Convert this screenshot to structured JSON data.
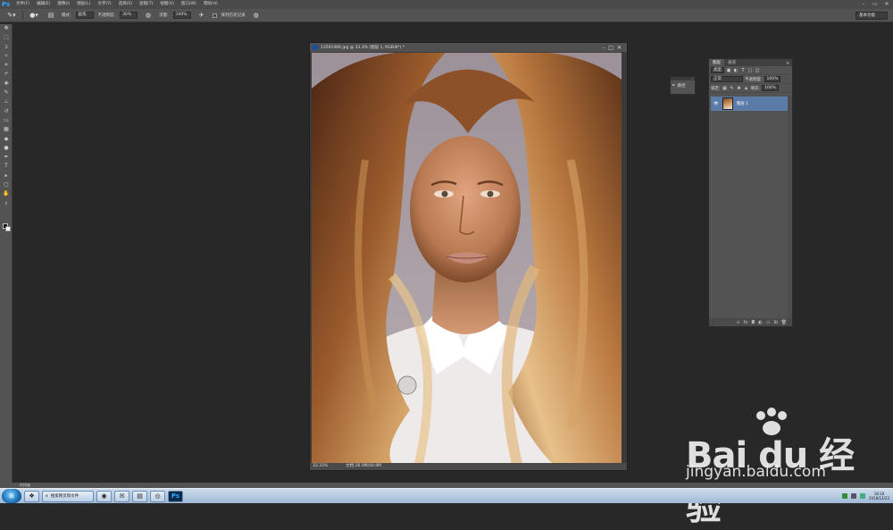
{
  "app": {
    "logo": "Ps"
  },
  "menubar": {
    "items": [
      "文件(F)",
      "编辑(E)",
      "图像(I)",
      "图层(L)",
      "文字(Y)",
      "选择(S)",
      "滤镜(T)",
      "视图(V)",
      "窗口(W)",
      "帮助(H)"
    ]
  },
  "options": {
    "mode_label": "模式:",
    "mode_value": "画笔",
    "opacity_label": "不透明度:",
    "opacity_value": "30%",
    "flow_label": "流量:",
    "flow_value": "100%",
    "erase_history_label": "抹到历史记录",
    "workspace": "基本功能"
  },
  "document": {
    "title": "13591489.jpg @ 33.3% (图层 1, RGB/8*) *",
    "zoom": "33.33%",
    "doc_size": "文档:26.0M/44.9M"
  },
  "mini_panel": {
    "label": "路径"
  },
  "layers_panel": {
    "tabs": [
      "图层",
      "通道"
    ],
    "kind_label": "类型",
    "blend_mode": "正常",
    "opacity_label": "不透明度:",
    "opacity_value": "100%",
    "lock_label": "锁定:",
    "fill_label": "填充:",
    "fill_value": "100%",
    "layer_name": "图层 1"
  },
  "bottom_bar": {
    "label": "时间轴"
  },
  "taskbar": {
    "search_task": "搜索网页和文件",
    "clock_time": "18:18",
    "clock_date": "2018/12/22"
  },
  "watermark": {
    "brand": "Bai du 经验",
    "url": "jingyan.baidu.com"
  }
}
